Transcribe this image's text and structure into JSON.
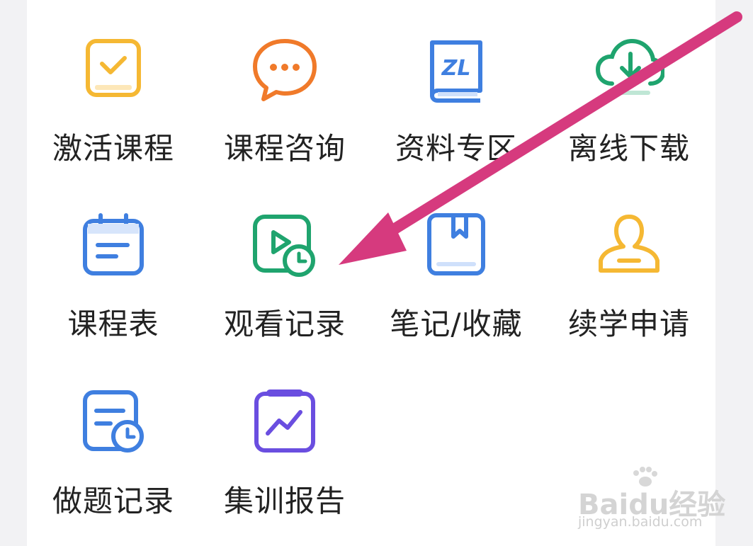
{
  "menu": {
    "items": [
      {
        "label": "激活课程",
        "icon": "activate-course-icon",
        "color": "#f5b833"
      },
      {
        "label": "课程咨询",
        "icon": "chat-bubble-icon",
        "color": "#f07a2a"
      },
      {
        "label": "资料专区",
        "icon": "book-icon",
        "color": "#3f7fe0"
      },
      {
        "label": "离线下载",
        "icon": "cloud-download-icon",
        "color": "#1fa46e"
      },
      {
        "label": "课程表",
        "icon": "calendar-icon",
        "color": "#3f7fe0"
      },
      {
        "label": "观看记录",
        "icon": "video-history-icon",
        "color": "#1fa46e"
      },
      {
        "label": "笔记/收藏",
        "icon": "bookmark-book-icon",
        "color": "#3f7fe0"
      },
      {
        "label": "续学申请",
        "icon": "person-icon",
        "color": "#f5b833"
      },
      {
        "label": "做题记录",
        "icon": "exercise-history-icon",
        "color": "#3f7fe0"
      },
      {
        "label": "集训报告",
        "icon": "report-chart-icon",
        "color": "#6a4ee0"
      }
    ]
  },
  "annotation": {
    "arrow_color": "#d63a7e"
  },
  "watermark": {
    "logo": "Baidu经验",
    "url": "jingyan.baidu.com"
  }
}
